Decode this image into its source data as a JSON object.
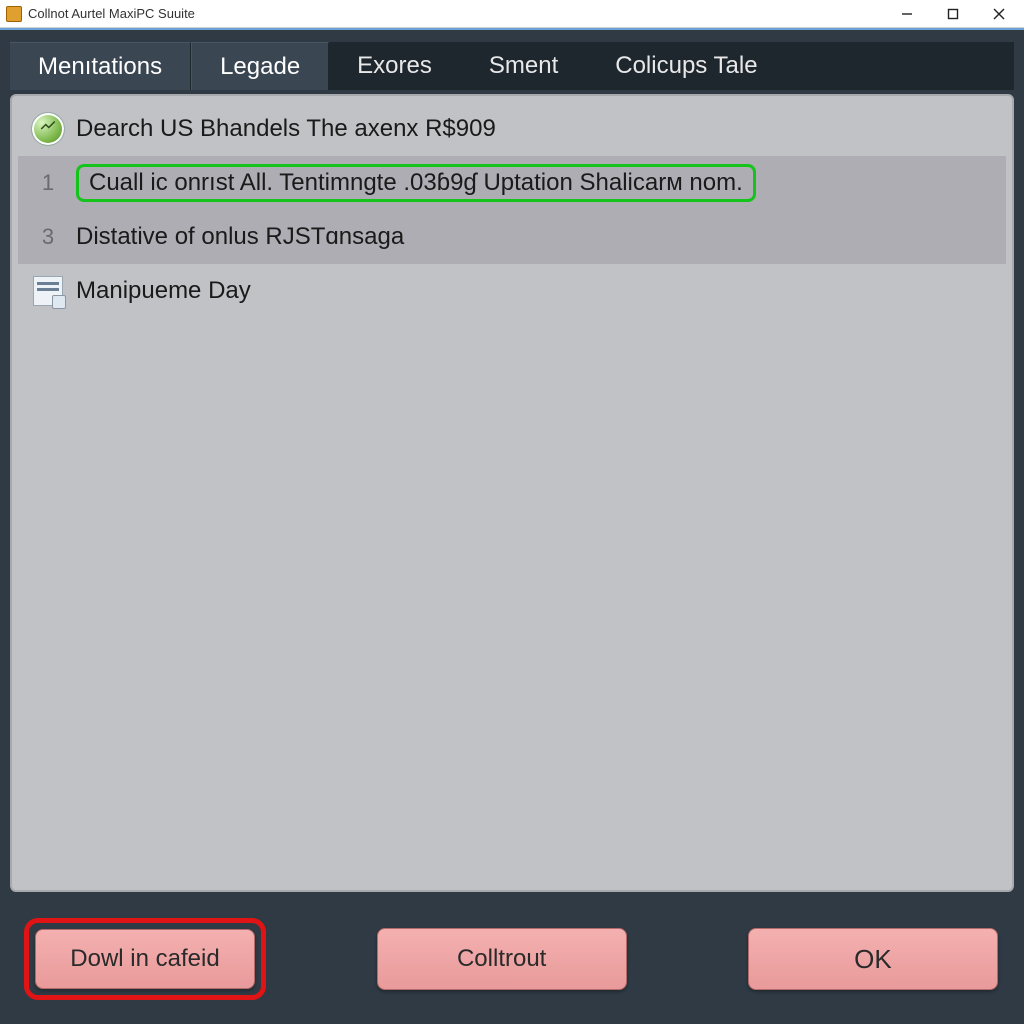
{
  "window": {
    "title": "Collnot Aurtel MaxiPC Suuite"
  },
  "tabs": {
    "items": [
      {
        "label": "Menıtations",
        "active": true
      },
      {
        "label": "Legade",
        "active": true
      },
      {
        "label": "Exores",
        "active": false
      },
      {
        "label": "Sment",
        "active": false
      },
      {
        "label": "Colicups Tale",
        "active": false
      }
    ]
  },
  "list": {
    "rows": [
      {
        "kind": "icon-round",
        "text": "Dearch US Bhandels The axenx R$909"
      },
      {
        "kind": "num",
        "num": "1",
        "text": "Cuall ic onrıst All. Tentimngte .03ɓ9ɠ Uptation Shalicarм nom.",
        "alt": true,
        "highlight": true
      },
      {
        "kind": "num",
        "num": "3",
        "text": "Distative of onlus RJSTɑnsaga",
        "alt": true
      },
      {
        "kind": "icon-doc",
        "text": "Manipueme Day"
      }
    ]
  },
  "buttons": {
    "primary": "Dowl in cafeid",
    "middle": "Colltrout",
    "ok": "OK"
  }
}
